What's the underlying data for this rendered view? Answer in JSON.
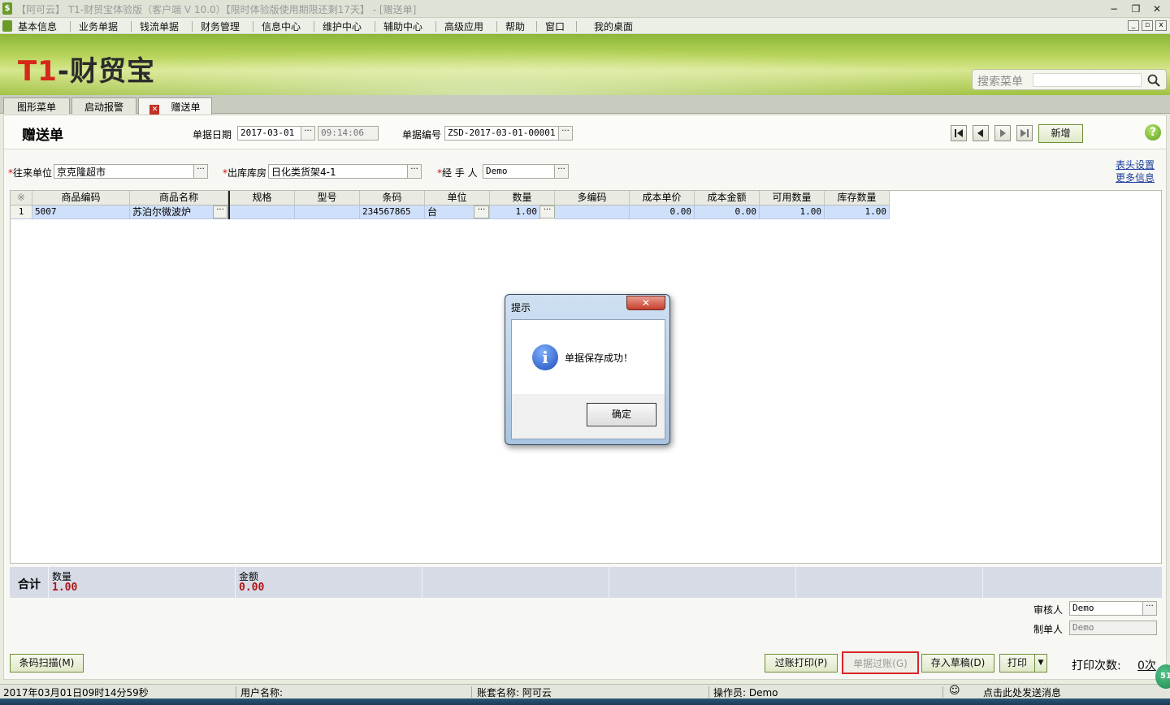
{
  "window": {
    "title": "【阿可云】 T1-财贸宝体验版（客户端 V 10.0）【限时体验版使用期限还剩17天】 - [赠送单]",
    "min": "−",
    "restore": "❐",
    "close": "✕"
  },
  "menu": {
    "items": [
      "基本信息",
      "业务单据",
      "钱流单据",
      "财务管理",
      "信息中心",
      "维护中心",
      "辅助中心",
      "高级应用",
      "帮助",
      "窗口",
      "我的桌面"
    ]
  },
  "banner": {
    "logo_t1": "T1",
    "logo_rest": "-财贸宝",
    "search_label": "搜索菜单",
    "search_value": ""
  },
  "tabs": [
    "图形菜单",
    "启动报警",
    "赠送单"
  ],
  "form": {
    "title": "赠送单",
    "date_label": "单据日期",
    "date_value": "2017-03-01",
    "time_value": "09:14:06",
    "number_label": "单据编号",
    "number_value": "ZSD-2017-03-01-00001",
    "new_button": "新增",
    "partner_label": "往来单位",
    "partner_value": "京克隆超市",
    "warehouse_label": "出库库房",
    "warehouse_value": "日化类货架4-1",
    "handler_label": "经 手 人",
    "handler_value": "Demo",
    "link_header": "表头设置",
    "link_more": "更多信息",
    "required_mark": "*",
    "ellipsis": "···"
  },
  "grid": {
    "corner": "※",
    "columns": [
      "商品编码",
      "商品名称",
      "规格",
      "型号",
      "条码",
      "单位",
      "数量",
      "多编码",
      "成本单价",
      "成本金额",
      "可用数量",
      "库存数量"
    ],
    "rows": [
      {
        "n": "1",
        "code": "5007",
        "name": "苏泊尔微波炉",
        "spec": "",
        "model": "",
        "barcode": "234567865",
        "unit": "台",
        "qty": "1.00",
        "multi": "",
        "cost_price": "0.00",
        "cost_amount": "0.00",
        "avail": "1.00",
        "stock": "1.00"
      }
    ]
  },
  "totals": {
    "title": "合计",
    "qty_label": "数量",
    "qty_value": "1.00",
    "amount_label": "金额",
    "amount_value": "0.00"
  },
  "approval": {
    "auditor_label": "审核人",
    "auditor_value": "Demo",
    "maker_label": "制单人",
    "maker_value": "Demo"
  },
  "buttons": {
    "scan": "条码扫描(M)",
    "post_print": "过账打印(P)",
    "post": "单据过账(G)",
    "draft": "存入草稿(D)",
    "print": "打印",
    "print_arrow": "▼",
    "print_count_label": "打印次数:",
    "print_count_value": "0次"
  },
  "status": {
    "date": "2017年03月01日",
    "time": "09时14分59秒",
    "user_label": "用户名称:",
    "account": "账套名称: 阿可云",
    "operator": "操作员: Demo",
    "message": "点击此处发送消息"
  },
  "dialog": {
    "title": "提示",
    "close": "✕",
    "icon": "i",
    "message": "单据保存成功！",
    "ok": "确定"
  },
  "badge": "51",
  "colors": {
    "accent_green": "#8cb637",
    "required_red": "#d01010",
    "total_value_red": "#b01515",
    "selected_row": "#cfe0fb",
    "highlight_box": "#d9262a"
  }
}
